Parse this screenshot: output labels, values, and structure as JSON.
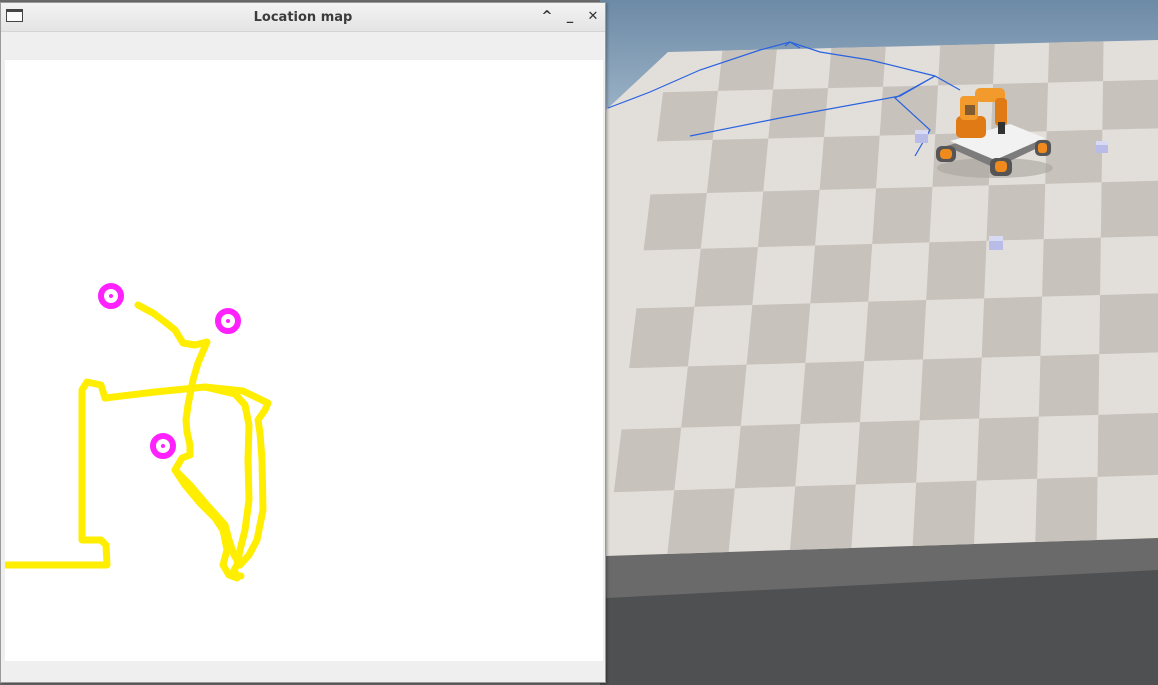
{
  "window": {
    "title": "Location map",
    "maximize_symbol": "^",
    "minimize_symbol": "_",
    "close_symbol": "✕"
  },
  "map": {
    "path_color": "#ffee00",
    "marker_color": "#ff22ff",
    "background_color": "#ffffff"
  },
  "scene": {
    "floor_light": "#e2ded9",
    "floor_dark": "#c7c2bb",
    "sky": "#7f9bb5",
    "trajectory_color": "#2a63e0",
    "robot_color": "#f08a1c"
  },
  "icons": {
    "window_menu": "window-menu-icon",
    "robot": "mobile-manipulator-robot"
  }
}
